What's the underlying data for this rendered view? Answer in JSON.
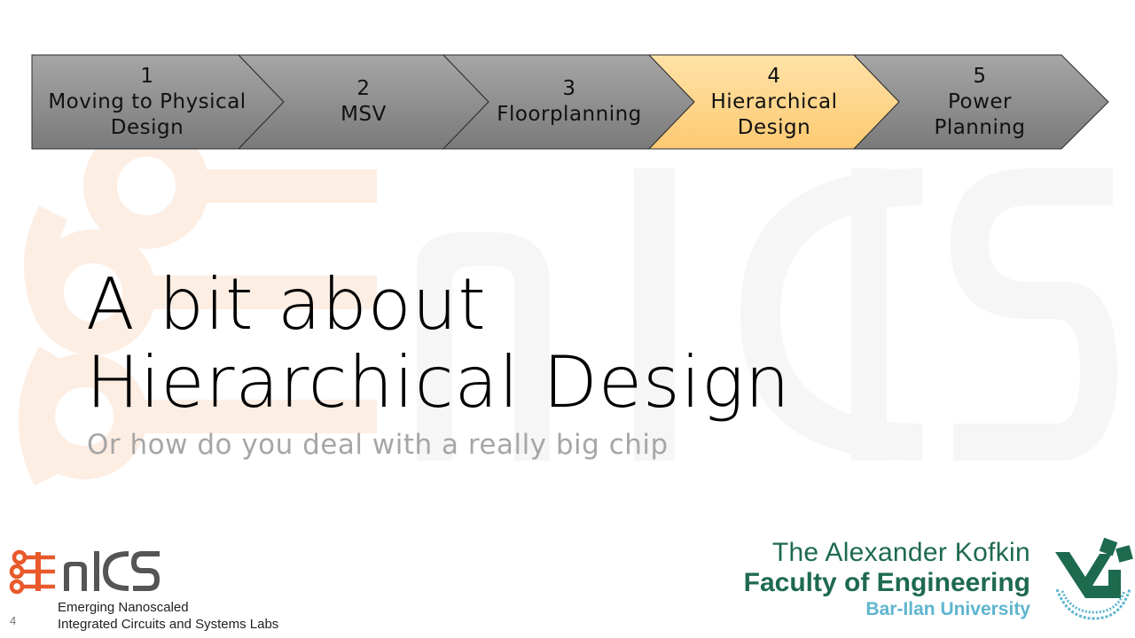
{
  "process_steps": [
    {
      "number": "1",
      "label_lines": [
        "Moving to Physical",
        "Design"
      ],
      "active": false
    },
    {
      "number": "2",
      "label_lines": [
        "MSV"
      ],
      "active": false
    },
    {
      "number": "3",
      "label_lines": [
        "Floorplanning"
      ],
      "active": false
    },
    {
      "number": "4",
      "label_lines": [
        "Hierarchical",
        "Design"
      ],
      "active": true
    },
    {
      "number": "5",
      "label_lines": [
        "Power",
        "Planning"
      ],
      "active": false
    }
  ],
  "colors": {
    "step_fill": "#8c8c8c",
    "step_active_fill": "#ffd58e",
    "watermark_orange": "#fdeee4",
    "watermark_gray": "#f6f6f6",
    "enics_orange": "#e8592b",
    "enics_gray": "#555555",
    "faculty_green": "#1e6a4f",
    "university_blue": "#5eb5cf"
  },
  "title": {
    "line1": "A bit about",
    "line2": "Hierarchical Design"
  },
  "subtitle": "Or how do you deal with a really big chip",
  "enics_logo": {
    "text": "EnICS",
    "caption_line1": "Emerging Nanoscaled",
    "caption_line2": "Integrated Circuits and Systems Labs"
  },
  "faculty": {
    "line1": "The Alexander Kofkin",
    "line2": "Faculty of Engineering",
    "line3": "Bar-Ilan University"
  },
  "slide_number": "4",
  "icons": {
    "enics_logo": "enics-logo-icon",
    "university_emblem": "bar-ilan-emblem-icon"
  }
}
